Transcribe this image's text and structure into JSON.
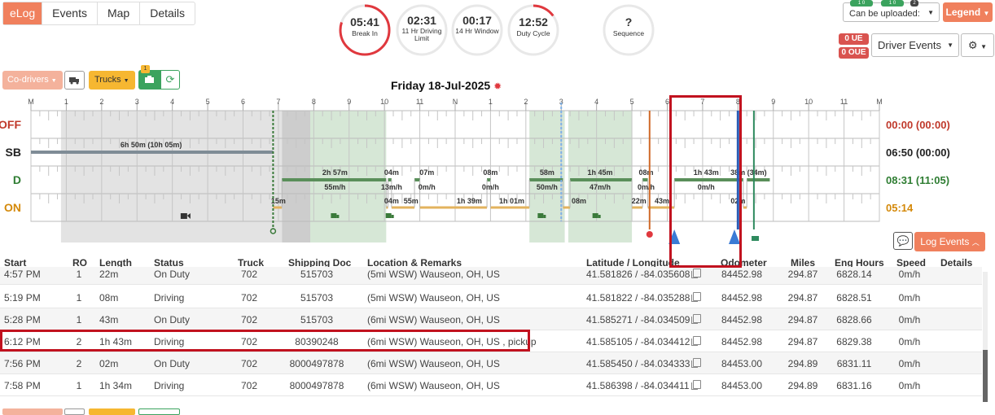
{
  "nav": {
    "tabs": [
      "eLog",
      "Events",
      "Map",
      "Details"
    ]
  },
  "timers": [
    {
      "value": "05:41",
      "label": "Break In",
      "progress": 0.8,
      "color": "#e0383e"
    },
    {
      "value": "02:31",
      "label": "11 Hr\nDriving Limit",
      "progress": 0,
      "color": "#e0383e"
    },
    {
      "value": "00:17",
      "label": "14 Hr\nWindow",
      "progress": 0,
      "color": "#e0383e"
    },
    {
      "value": "12:52",
      "label": "Duty Cycle",
      "progress": 0.15,
      "color": "#e0383e"
    },
    {
      "value": "?",
      "label": "Sequence",
      "progress": 0,
      "color": "#e0383e"
    }
  ],
  "upload": {
    "label": "Can be uploaded:",
    "pill_1": "1 0",
    "pill_2": "1 0",
    "pill_3": "2"
  },
  "legend_label": "Legend",
  "badges": {
    "ue": "0 UE",
    "oue": "0 OUE"
  },
  "driver_events_label": "Driver Events",
  "toolbar": {
    "codrivers": "Co-drivers",
    "trucks": "Trucks",
    "trucks_badge": "1"
  },
  "date_title": "Friday 18-Jul-2025",
  "chart": {
    "hour_labels": [
      "M",
      "1",
      "2",
      "3",
      "4",
      "5",
      "6",
      "7",
      "8",
      "9",
      "10",
      "11",
      "N",
      "1",
      "2",
      "3",
      "4",
      "5",
      "6",
      "7",
      "8",
      "9",
      "10",
      "11",
      "M"
    ],
    "statuses": [
      "OFF",
      "SB",
      "D",
      "ON"
    ],
    "status_colors": [
      "#c0392b",
      "#222222",
      "#2e7d32",
      "#d4890a"
    ],
    "totals": [
      "00:00 (00:00)",
      "06:50 (00:00)",
      "08:31 (11:05)",
      "05:14"
    ],
    "sb_label": "6h 50m (10h 05m)",
    "d_labels": [
      {
        "h": 8.6,
        "text": "2h 57m",
        "row": "top"
      },
      {
        "h": 8.6,
        "text": "55m/h",
        "row": "bot"
      },
      {
        "h": 10.2,
        "text": "04m",
        "row": "top"
      },
      {
        "h": 10.2,
        "text": "13m/h",
        "row": "bot"
      },
      {
        "h": 11.2,
        "text": "07m",
        "row": "top"
      },
      {
        "h": 11.2,
        "text": "0m/h",
        "row": "bot"
      },
      {
        "h": 13.0,
        "text": "08m",
        "row": "top"
      },
      {
        "h": 13.0,
        "text": "0m/h",
        "row": "bot"
      },
      {
        "h": 14.6,
        "text": "58m",
        "row": "top"
      },
      {
        "h": 14.6,
        "text": "50m/h",
        "row": "bot"
      },
      {
        "h": 16.1,
        "text": "1h 45m",
        "row": "top"
      },
      {
        "h": 16.1,
        "text": "47m/h",
        "row": "bot"
      },
      {
        "h": 17.4,
        "text": "08m",
        "row": "top"
      },
      {
        "h": 17.4,
        "text": "0m/h",
        "row": "bot"
      },
      {
        "h": 19.1,
        "text": "1h 43m",
        "row": "top"
      },
      {
        "h": 19.1,
        "text": "0m/h",
        "row": "bot"
      },
      {
        "h": 20.3,
        "text": "38m (34m)",
        "row": "top"
      }
    ],
    "on_labels": [
      {
        "h": 7.0,
        "text": "15m"
      },
      {
        "h": 10.2,
        "text": "04m"
      },
      {
        "h": 10.75,
        "text": "55m"
      },
      {
        "h": 12.4,
        "text": "1h 39m"
      },
      {
        "h": 13.6,
        "text": "1h 01m"
      },
      {
        "h": 15.5,
        "text": "08m"
      },
      {
        "h": 17.2,
        "text": "22m"
      },
      {
        "h": 17.85,
        "text": "43m"
      },
      {
        "h": 20.0,
        "text": "02m"
      }
    ]
  },
  "log_events_label": "Log Events",
  "table": {
    "headers": [
      "Start",
      "RO",
      "Length",
      "Status",
      "Truck",
      "Shipping Doc",
      "Location & Remarks",
      "Latitude / Longitude",
      "Odometer",
      "Miles",
      "Eng Hours",
      "Speed",
      "Details"
    ],
    "rows": [
      {
        "start": "4:57 PM",
        "ro": "1",
        "length": "22m",
        "status": "On Duty",
        "truck": "702",
        "doc": "515703",
        "location": "(5mi WSW) Wauseon, OH, US",
        "latlon": "41.581826 / -84.035608",
        "odometer": "84452.98",
        "miles": "294.87",
        "eng": "6828.14",
        "speed": "0m/h"
      },
      {
        "start": "5:19 PM",
        "ro": "1",
        "length": "08m",
        "status": "Driving",
        "truck": "702",
        "doc": "515703",
        "location": "(5mi WSW) Wauseon, OH, US",
        "latlon": "41.581822 / -84.035288",
        "odometer": "84452.98",
        "miles": "294.87",
        "eng": "6828.51",
        "speed": "0m/h"
      },
      {
        "start": "5:28 PM",
        "ro": "1",
        "length": "43m",
        "status": "On Duty",
        "truck": "702",
        "doc": "515703",
        "location": "(6mi WSW) Wauseon, OH, US",
        "latlon": "41.585271 / -84.034509",
        "odometer": "84452.98",
        "miles": "294.87",
        "eng": "6828.66",
        "speed": "0m/h"
      },
      {
        "start": "6:12 PM",
        "ro": "2",
        "length": "1h 43m",
        "status": "Driving",
        "truck": "702",
        "doc": "80390248",
        "location": "(6mi WSW) Wauseon, OH, US , pickup",
        "latlon": "41.585105 / -84.034412",
        "odometer": "84452.98",
        "miles": "294.87",
        "eng": "6829.38",
        "speed": "0m/h"
      },
      {
        "start": "7:56 PM",
        "ro": "2",
        "length": "02m",
        "status": "On Duty",
        "truck": "702",
        "doc": "8000497878",
        "location": "(6mi WSW) Wauseon, OH, US",
        "latlon": "41.585450 / -84.034333",
        "odometer": "84453.00",
        "miles": "294.89",
        "eng": "6831.11",
        "speed": "0m/h"
      },
      {
        "start": "7:58 PM",
        "ro": "1",
        "length": "1h 34m",
        "status": "Driving",
        "truck": "702",
        "doc": "8000497878",
        "location": "(6mi WSW) Wauseon, OH, US",
        "latlon": "41.586398 / -84.034411",
        "odometer": "84453.00",
        "miles": "294.89",
        "eng": "6831.16",
        "speed": "0m/h"
      }
    ]
  }
}
